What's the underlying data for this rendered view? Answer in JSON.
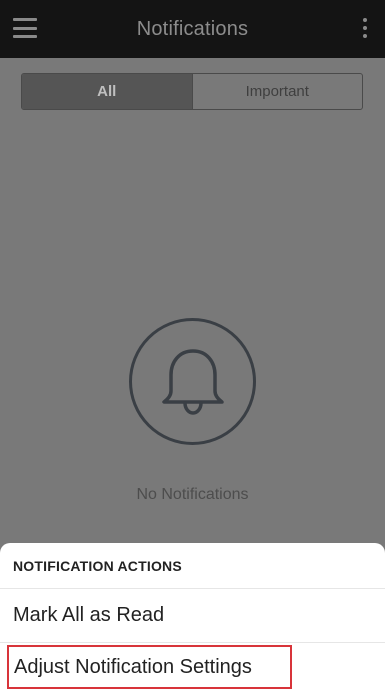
{
  "appbar": {
    "title": "Notifications",
    "menu_icon": "hamburger-menu-icon",
    "overflow_icon": "more-vertical-icon"
  },
  "tabs": [
    {
      "label": "All",
      "selected": true
    },
    {
      "label": "Important",
      "selected": false
    }
  ],
  "empty_state": {
    "icon": "bell-icon",
    "text": "No Notifications"
  },
  "action_sheet": {
    "header": "NOTIFICATION ACTIONS",
    "items": [
      {
        "label": "Mark All as Read"
      },
      {
        "label": "Adjust Notification Settings"
      }
    ]
  },
  "colors": {
    "appbar_bg": "#141414",
    "scrim_bg": "#797979",
    "highlight_border": "#d8343a"
  }
}
